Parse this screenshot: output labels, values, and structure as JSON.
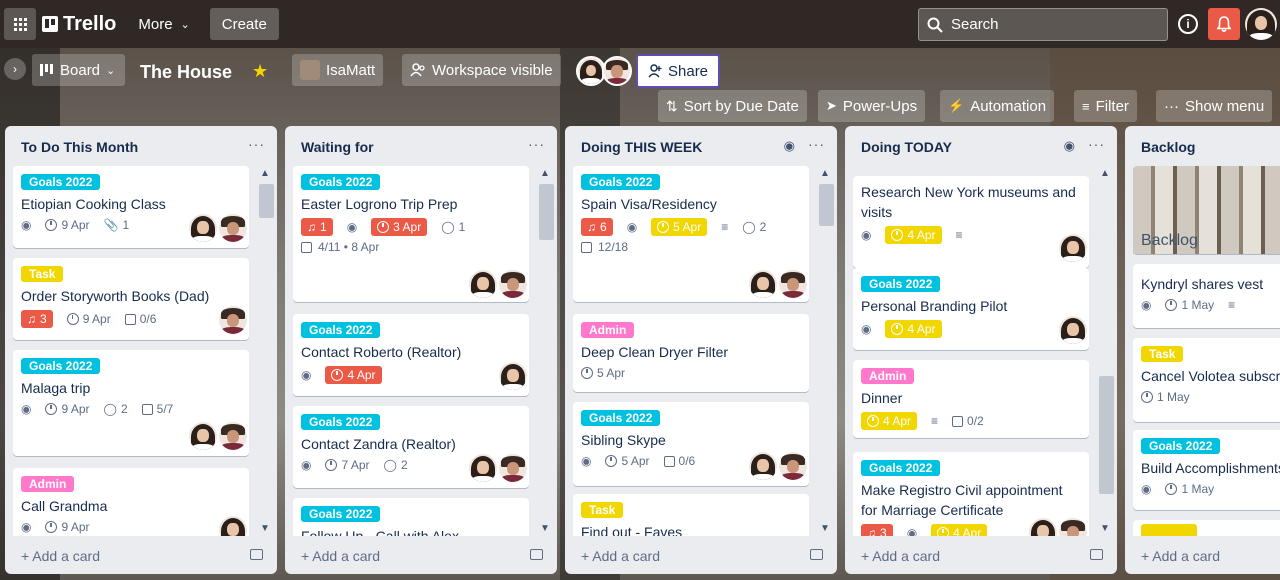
{
  "topbar": {
    "brand": "Trello",
    "more": "More",
    "create": "Create",
    "search_placeholder": "Search",
    "info": "i"
  },
  "board": {
    "view": "Board",
    "title": "The House",
    "workspace": "IsaMatt",
    "visibility": "Workspace visible",
    "share": "Share",
    "sort": "Sort by Due Date",
    "powerups": "Power-Ups",
    "automation": "Automation",
    "filter": "Filter",
    "show_menu": "Show menu"
  },
  "add_card": "+ Add a card",
  "lists": [
    {
      "title": "To Do This Month",
      "cards": [
        {
          "label": "Goals 2022",
          "title": "Etiopian Cooking Class",
          "due": "9 Apr",
          "attachments": "1"
        },
        {
          "label": "Task",
          "title": "Order Storyworth Books (Dad)",
          "notif": "3",
          "due": "9 Apr",
          "checklist": "0/6"
        },
        {
          "label": "Goals 2022",
          "title": "Malaga trip",
          "due": "9 Apr",
          "comments": "2",
          "checklist": "5/7"
        },
        {
          "label": "Admin",
          "title": "Call Grandma",
          "due": "9 Apr"
        }
      ]
    },
    {
      "title": "Waiting for",
      "cards": [
        {
          "label": "Goals 2022",
          "title": "Easter Logrono Trip Prep",
          "notif": "1",
          "due": "3 Apr",
          "comments": "1",
          "checklist": "4/11 • 8 Apr"
        },
        {
          "label": "Goals 2022",
          "title": "Contact Roberto (Realtor)",
          "due": "4 Apr"
        },
        {
          "label": "Goals 2022",
          "title": "Contact Zandra (Realtor)",
          "due": "7 Apr",
          "comments": "2"
        },
        {
          "label": "Goals 2022",
          "title": "Follow Up - Call with Alex"
        }
      ]
    },
    {
      "title": "Doing THIS WEEK",
      "cards": [
        {
          "label": "Goals 2022",
          "title": "Spain Visa/Residency",
          "notif": "6",
          "due": "5 Apr",
          "comments": "2",
          "checklist": "12/18"
        },
        {
          "label": "Admin",
          "title": "Deep Clean Dryer Filter",
          "due": "5 Apr"
        },
        {
          "label": "Goals 2022",
          "title": "Sibling Skype",
          "due": "5 Apr",
          "checklist": "0/6"
        },
        {
          "label": "Task",
          "title": "Find out - Faves"
        }
      ]
    },
    {
      "title": "Doing TODAY",
      "cards": [
        {
          "title": "Research New York museums and visits",
          "due": "4 Apr"
        },
        {
          "label": "Goals 2022",
          "title": "Personal Branding Pilot",
          "due": "4 Apr"
        },
        {
          "label": "Admin",
          "title": "Dinner",
          "due": "4 Apr",
          "checklist": "0/2"
        },
        {
          "label": "Goals 2022",
          "title": "Make Registro Civil appointment for Marriage Certificate",
          "notif": "3",
          "due": "4 Apr"
        }
      ]
    },
    {
      "title": "Backlog",
      "cards": [
        {
          "cover_title": "Backlog"
        },
        {
          "title": "Kyndryl shares vest",
          "due": "1 May"
        },
        {
          "label": "Task",
          "title": "Cancel Volotea subscri",
          "due": "1 May"
        },
        {
          "label": "Goals 2022",
          "title": "Build Accomplishments",
          "due": "1 May"
        }
      ]
    }
  ],
  "colors": {
    "goals": "#00c2e0",
    "task": "#f2d600",
    "admin": "#ff78cb",
    "overdue": "#eb5a46",
    "due_soon": "#f2d600",
    "share_border": "#5e4db2"
  }
}
